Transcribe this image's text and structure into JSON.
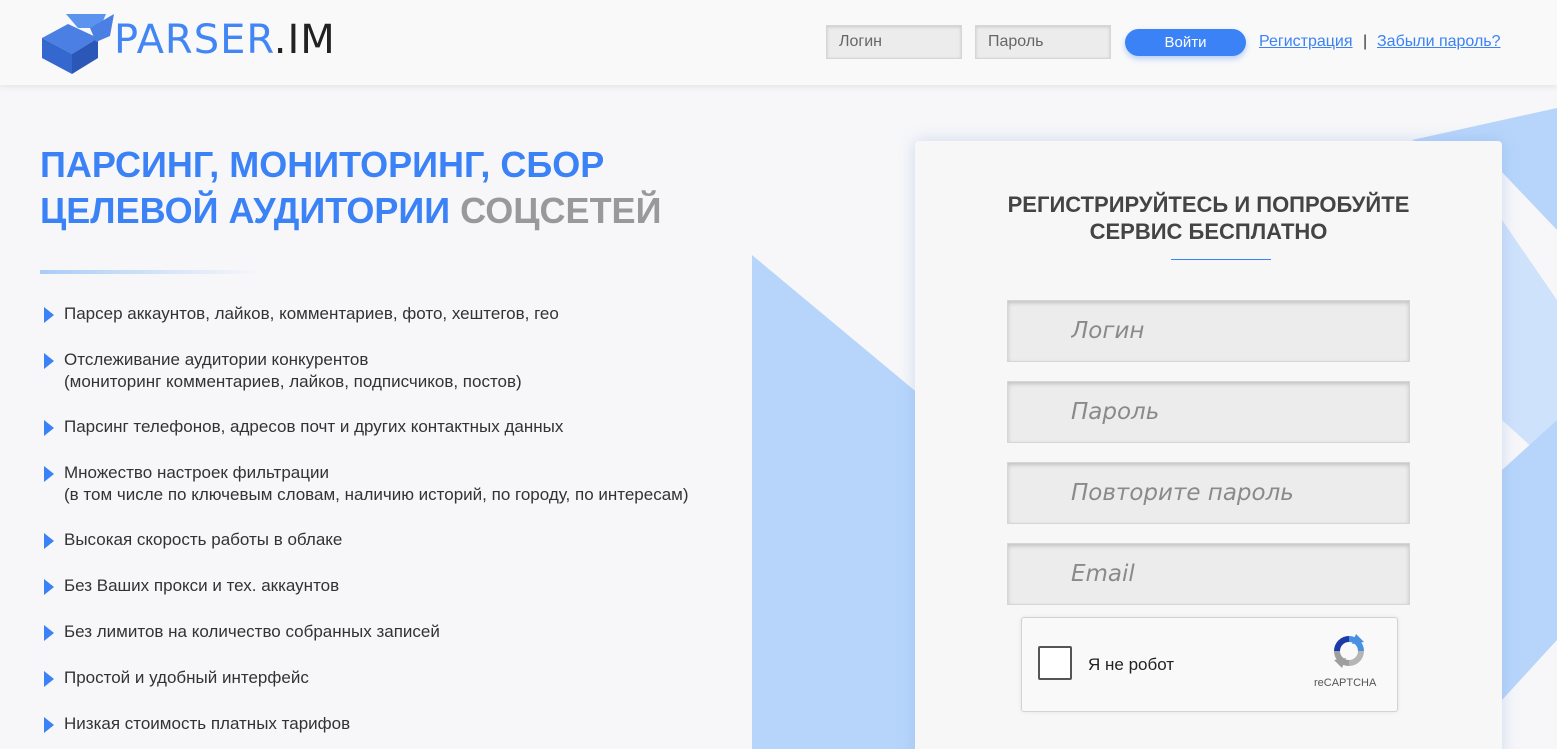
{
  "header": {
    "logo_text_blue": "PARSER",
    "logo_text_dark": ".IM",
    "login_placeholder": "Логин",
    "password_placeholder": "Пароль",
    "login_button": "Войти",
    "register_link": "Регистрация",
    "separator": "|",
    "forgot_link": "Забыли пароль?"
  },
  "hero": {
    "headline_blue": "ПАРСИНГ, МОНИТОРИНГ, СБОР ЦЕЛЕВОЙ АУДИТОРИИ",
    "headline_grey": "СОЦСЕТЕЙ"
  },
  "features": [
    {
      "line1": "Парсер аккаунтов, лайков, комментариев, фото, хештегов, гео",
      "line2": ""
    },
    {
      "line1": "Отслеживание аудитории конкурентов",
      "line2": "(мониторинг комментариев, лайков, подписчиков, постов)"
    },
    {
      "line1": "Парсинг телефонов, адресов почт и других контактных данных",
      "line2": ""
    },
    {
      "line1": "Множество настроек фильтрации",
      "line2": "(в том числе по ключевым словам, наличию историй, по городу, по интересам)"
    },
    {
      "line1": "Высокая скорость работы в облаке",
      "line2": ""
    },
    {
      "line1": "Без Ваших прокси и тех. аккаунтов",
      "line2": ""
    },
    {
      "line1": "Без лимитов на количество собранных записей",
      "line2": ""
    },
    {
      "line1": "Простой и удобный интерфейс",
      "line2": ""
    },
    {
      "line1": "Низкая стоимость платных тарифов",
      "line2": ""
    }
  ],
  "signup": {
    "title_line1": "РЕГИСТРИРУЙТЕСЬ И ПОПРОБУЙТЕ",
    "title_line2": "СЕРВИС БЕСПЛАТНО",
    "login_placeholder": "Логин",
    "password_placeholder": "Пароль",
    "repeat_password_placeholder": "Повторите пароль",
    "email_placeholder": "Email"
  },
  "recaptcha": {
    "label": "Я не робот",
    "brand": "reCAPTCHA"
  },
  "colors": {
    "accent": "#3b82f6",
    "decor": "#b7d5fb"
  }
}
